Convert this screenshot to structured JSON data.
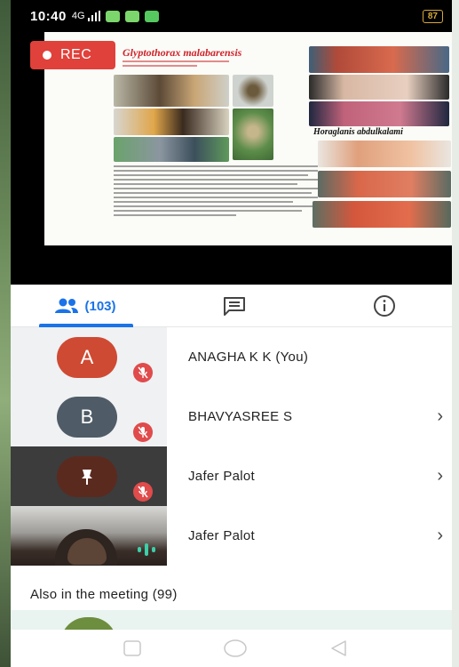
{
  "status_bar": {
    "time": "10:40",
    "signal": "4G",
    "battery": "87"
  },
  "presentation": {
    "rec_label": "REC",
    "slide_title": "Glyptothorax malabarensis",
    "slide_right_title": "Horaglanis abdulkalami"
  },
  "tabs": {
    "people_count": "(103)",
    "chat_icon": "chat-icon",
    "info_icon": "info-icon"
  },
  "participants": [
    {
      "initial": "A",
      "name": "ANAGHA K K (You)",
      "avatar_color": "#cf4a33",
      "muted": true
    },
    {
      "initial": "B",
      "name": "BHAVYASREE S",
      "avatar_color": "#4f5b66",
      "muted": true
    },
    {
      "initial": "",
      "name": "Jafer Palot",
      "avatar_color": "#5b2a1f",
      "muted": true
    },
    {
      "initial": "",
      "name": "Jafer Palot",
      "avatar_color": "",
      "muted": false
    }
  ],
  "also_in_meeting": "Also in the meeting (99)",
  "colors": {
    "accent": "#1a73e8",
    "rec": "#e0413a",
    "muted_badge": "#e04b4b",
    "speaking": "#3ccfa8"
  }
}
